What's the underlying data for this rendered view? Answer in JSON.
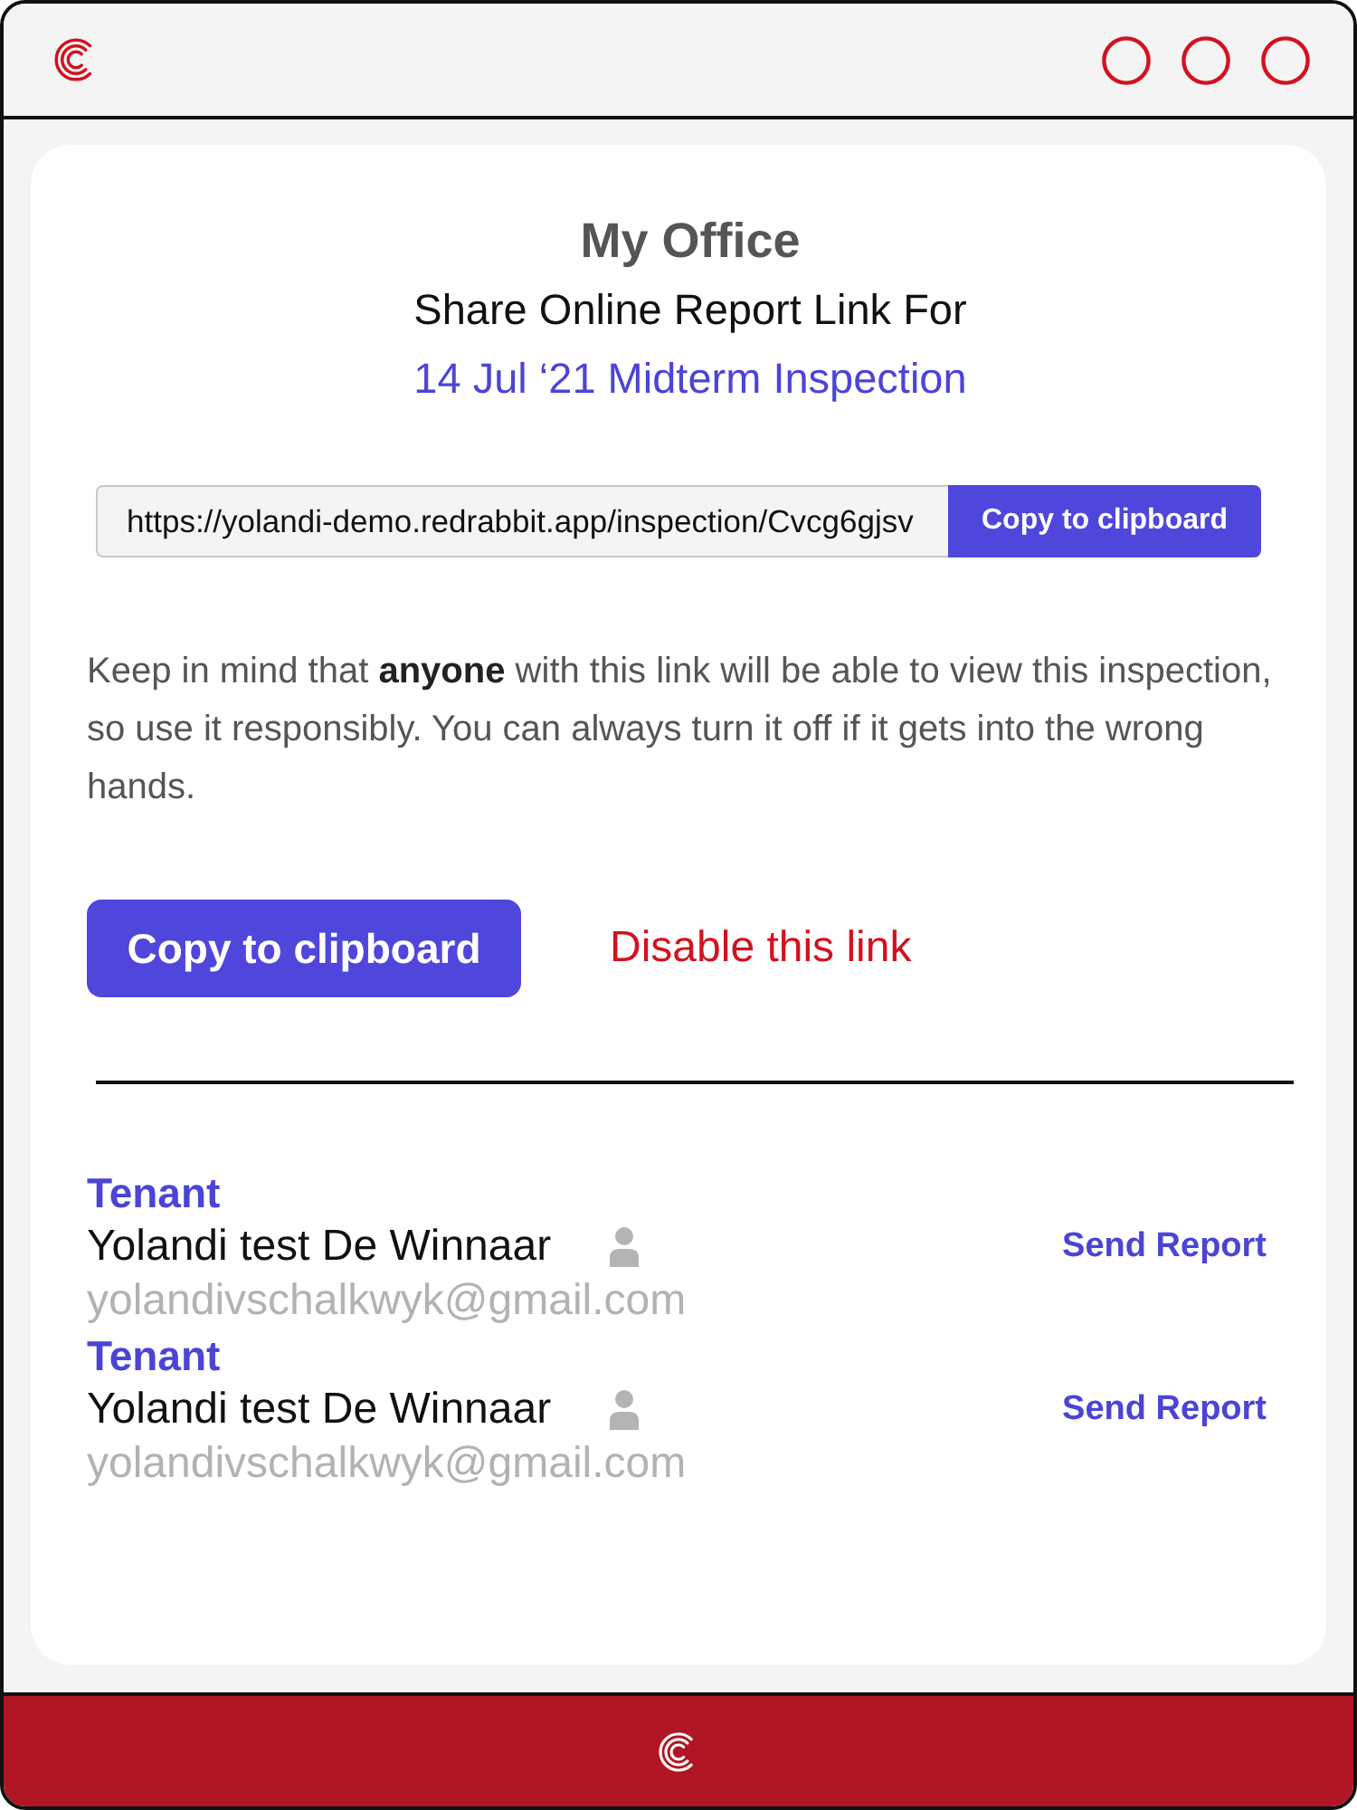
{
  "header": {
    "office": "My Office",
    "subtitle": "Share Online Report Link For",
    "inspection": "14 Jul ‘21 Midterm Inspection"
  },
  "link": {
    "value": "https://yolandi-demo.redrabbit.app/inspection/Cvcg6gjsv",
    "button": "Copy to clipboard"
  },
  "notice": "Keep in mind that **anyone** with this link will be able to view this inspection, so use it responsibly. You can always turn it off if it gets into the wrong hands.",
  "actions": [
    {
      "kind": "primary",
      "label": "Copy to clipboard"
    },
    {
      "kind": "danger",
      "label": "Disable this link"
    }
  ],
  "recipients": [
    {
      "role": "Tenant",
      "name": "Yolandi test De Winnaar",
      "email": "yolandivschalkwyk@gmail.com",
      "action": "Send Report"
    },
    {
      "role": "Tenant",
      "name": "Yolandi test De Winnaar",
      "email": "yolandivschalkwyk@gmail.com",
      "action": "Send Report"
    }
  ]
}
